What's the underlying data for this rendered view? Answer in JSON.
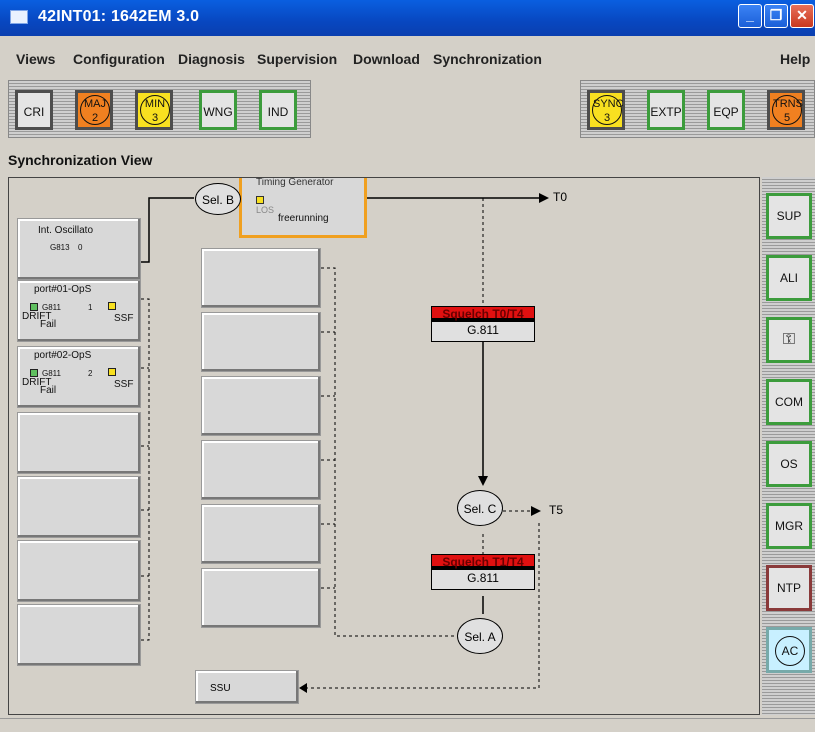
{
  "window": {
    "title": "42INT01: 1642EM 3.0"
  },
  "menu": {
    "items": [
      "Views",
      "Configuration",
      "Diagnosis",
      "Supervision",
      "Download",
      "Synchronization"
    ],
    "help": "Help"
  },
  "alarms_left": [
    {
      "label": "CRI",
      "count": null
    },
    {
      "label": "MAJ",
      "count": "2",
      "color": "#f08020"
    },
    {
      "label": "MIN",
      "count": "3",
      "color": "#f8e020"
    },
    {
      "label": "WNG",
      "count": null
    },
    {
      "label": "IND",
      "count": null
    }
  ],
  "alarms_right": [
    {
      "label": "SYNC",
      "count": "3",
      "color": "#f8e020"
    },
    {
      "label": "EXTP",
      "count": null
    },
    {
      "label": "EQP",
      "count": null
    },
    {
      "label": "TRNS",
      "count": "5",
      "color": "#f08020"
    }
  ],
  "view_title": "Synchronization View",
  "timing_generator": {
    "title": "Timing Generator",
    "los": "LOS",
    "state": "freerunning"
  },
  "selectors": {
    "b": "Sel. B",
    "c": "Sel. C",
    "a": "Sel. A"
  },
  "outputs": {
    "t0": "T0",
    "t5": "T5"
  },
  "sources": {
    "oscillator": {
      "name": "Int. Oscillato",
      "standard": "G813",
      "priority": "0"
    },
    "port1": {
      "name": "port#01-OpS",
      "standard": "G811",
      "priority": "1",
      "drift": "DRIFT",
      "fail": "Fail",
      "ssf": "SSF"
    },
    "port2": {
      "name": "port#02-OpS",
      "standard": "G811",
      "priority": "2",
      "drift": "DRIFT",
      "fail": "Fail",
      "ssf": "SSF"
    }
  },
  "squelch": [
    {
      "title": "Squelch T0/T4",
      "value": "G.811"
    },
    {
      "title": "Squelch T1/T4",
      "value": "G.811"
    }
  ],
  "ssu": "SSU",
  "right_panel": [
    "SUP",
    "ALI",
    "key-icon",
    "COM",
    "OS",
    "MGR",
    "NTP",
    "AC"
  ],
  "colors": {
    "title_bar": "#0847c0",
    "alarm_major": "#f08020",
    "alarm_minor": "#f8e020",
    "squelch": "#e01010",
    "timing_border": "#f0a020"
  }
}
